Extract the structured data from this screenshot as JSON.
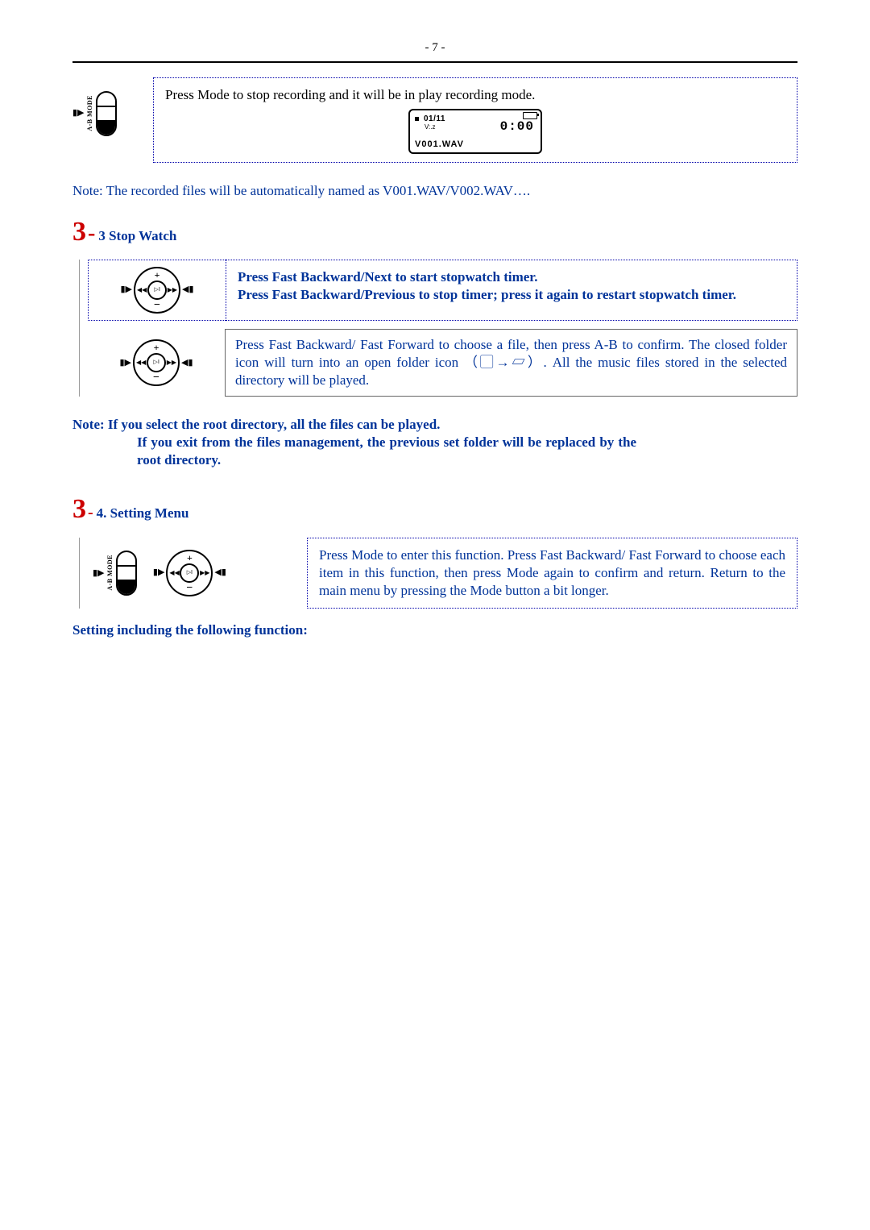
{
  "page_number": "- 7 -",
  "rec_box": {
    "text": "Press Mode to stop recording and it will be in play recording mode.",
    "lcd": {
      "track": "01/11",
      "voice": "V:.z",
      "time": "0:00",
      "file": "V001.WAV"
    }
  },
  "note_autoname": "Note: The recorded files will be automatically named as V001.WAV/V002.WAV….",
  "sec33": {
    "num": "3",
    "dash": "-",
    "title": "3 Stop Watch",
    "box1_line1": "Press Fast Backward/Next to start stopwatch timer.",
    "box1_line2": "Press Fast Backward/Previous to stop timer; press it again to restart stopwatch timer.",
    "box2": "Press Fast Backward/ Fast Forward to choose a file, then press A-B to confirm. The closed folder icon will turn into an open folder icon （▢→▱）. All the music files stored in the selected directory will be played."
  },
  "note33": {
    "line1": "Note: If you select the root directory, all the files can be played.",
    "line2": "If you exit from the files management, the previous set folder will be replaced by the root directory."
  },
  "sec34": {
    "num": "3",
    "dash": "-",
    "title": "4. Setting Menu",
    "box": "Press Mode to enter this function. Press Fast Backward/ Fast Forward to choose each item in this function, then press Mode again to confirm and return. Return to the main menu by pressing the Mode button a bit longer."
  },
  "setting_following": "Setting including the following function:"
}
